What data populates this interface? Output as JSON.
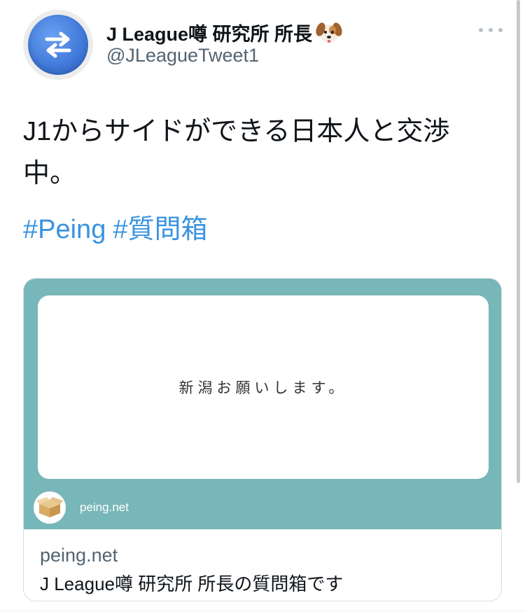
{
  "tweet": {
    "display_name": "J League噂 研究所 所長",
    "handle": "@JLeagueTweet1",
    "text": "J1からサイドができる日本人と交渉中。",
    "hashtags": [
      "#Peing",
      "#質問箱"
    ]
  },
  "card": {
    "question": "新潟お願いします。",
    "site_small": "peing.net",
    "domain": "peing.net",
    "title": "J League噂 研究所 所長の質問箱です"
  },
  "icons": {
    "avatar": "swap-arrows-icon",
    "name_emoji": "dog-face-icon",
    "more": "more-options-icon",
    "peing_logo": "cardboard-box-icon"
  },
  "colors": {
    "hashtag": "#3a93df",
    "card_background": "#78b7b9",
    "avatar_blue": "#3f78d9"
  }
}
